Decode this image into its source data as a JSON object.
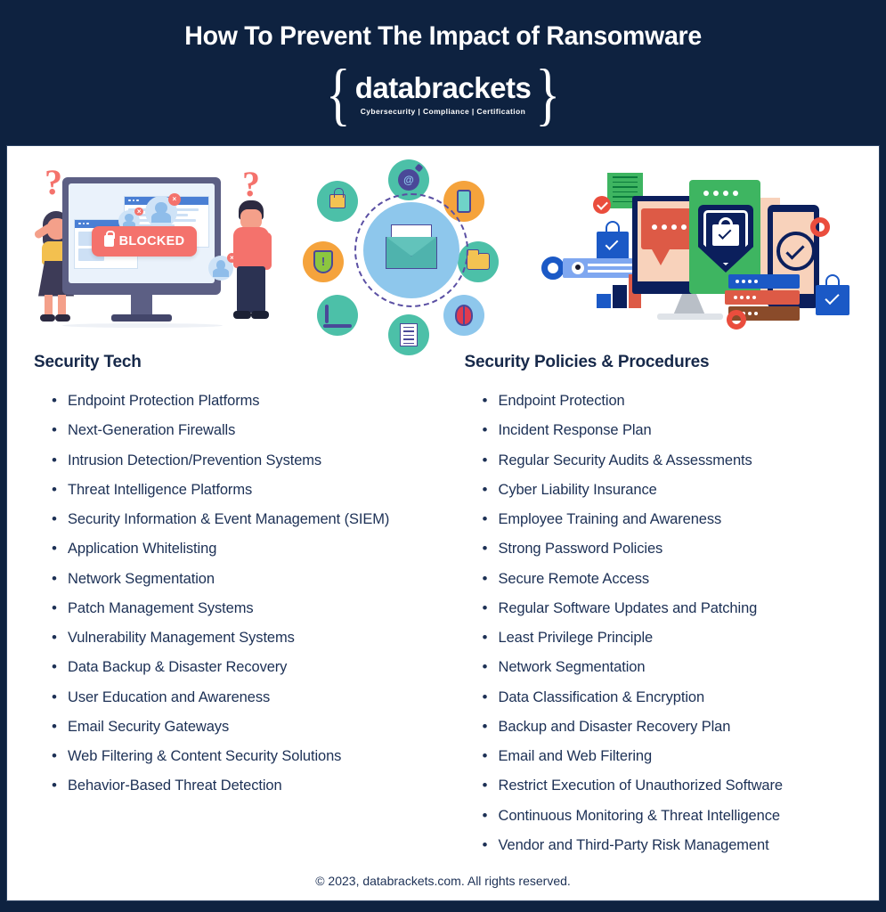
{
  "header": {
    "title": "How To Prevent The Impact of Ransomware",
    "logo": {
      "brace_left": "{",
      "brace_right": "}",
      "word": "databrackets",
      "tagline": "Cybersecurity | Compliance | Certification"
    }
  },
  "illustrations": {
    "left": {
      "name": "blocked-screen-illustration",
      "banner_label": "BLOCKED",
      "icons": [
        "question-mark-icon",
        "lock-icon",
        "monitor-icon",
        "user-blocked-icon"
      ]
    },
    "middle": {
      "name": "email-threats-illustration",
      "icons": [
        "envelope-icon",
        "padlock-icon",
        "bomb-at-icon",
        "smartphone-icon",
        "folder-icon",
        "bug-icon",
        "document-icon",
        "laptop-icon",
        "shield-alert-icon"
      ]
    },
    "right": {
      "name": "data-protection-illustration",
      "icons": [
        "shield-lock-icon",
        "monitor-icon",
        "smartphone-check-icon",
        "server-stack-icon",
        "gear-icon",
        "shopping-bag-check-icon",
        "document-check-icon",
        "search-bar-icon",
        "bar-chart-icon"
      ]
    }
  },
  "columns": [
    {
      "heading": "Security Tech",
      "items": [
        "Endpoint Protection Platforms",
        "Next-Generation Firewalls",
        "Intrusion Detection/Prevention Systems",
        "Threat Intelligence Platforms",
        "Security Information & Event Management (SIEM)",
        "Application Whitelisting",
        "Network Segmentation",
        "Patch Management Systems",
        "Vulnerability Management Systems",
        "Data Backup & Disaster Recovery",
        "User Education and Awareness",
        "Email Security Gateways",
        "Web Filtering & Content Security Solutions",
        "Behavior-Based Threat Detection"
      ]
    },
    {
      "heading": "Security Policies & Procedures",
      "items": [
        "Endpoint Protection",
        "Incident Response Plan",
        "Regular Security Audits & Assessments",
        "Cyber Liability Insurance",
        "Employee Training and Awareness",
        "Strong Password Policies",
        "Secure Remote Access",
        "Regular Software Updates and Patching",
        "Least Privilege Principle",
        "Network Segmentation",
        "Data Classification & Encryption",
        "Backup and Disaster Recovery Plan",
        "Email and Web Filtering",
        "Restrict Execution of Unauthorized Software",
        "Continuous Monitoring & Threat Intelligence",
        "Vendor and Third-Party Risk Management"
      ]
    }
  ],
  "footer": {
    "copyright": "© 2023, databrackets.com. All rights reserved."
  },
  "colors": {
    "header_background": "#0e2240",
    "card_background": "#ffffff",
    "text_navy": "#1c3055",
    "accent_coral": "#f4726c",
    "accent_teal": "#4cc0a8",
    "accent_orange": "#f5a33c",
    "accent_blue": "#1b59c6",
    "accent_green": "#3eb561"
  }
}
